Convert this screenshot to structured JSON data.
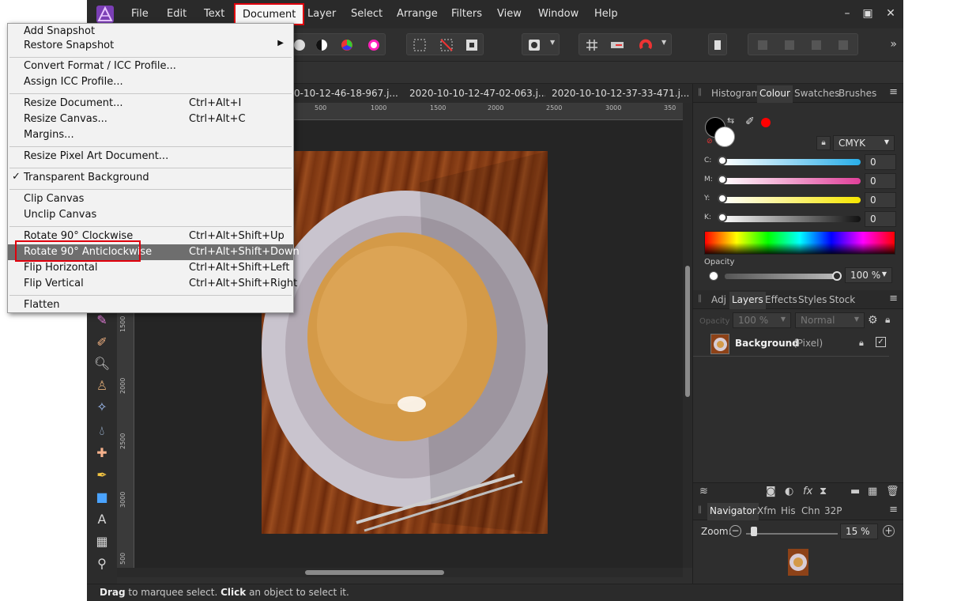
{
  "menubar": {
    "items": [
      "File",
      "Edit",
      "Text",
      "Document",
      "Layer",
      "Select",
      "Arrange",
      "Filters",
      "View",
      "Window",
      "Help"
    ],
    "active": "Document"
  },
  "document_menu": {
    "items": [
      {
        "label": "Add Snapshot",
        "shortcut": ""
      },
      {
        "label": "Restore Snapshot",
        "shortcut": "",
        "submenu": true
      },
      {
        "label": "Convert Format / ICC Profile...",
        "shortcut": ""
      },
      {
        "label": "Assign ICC Profile...",
        "shortcut": ""
      },
      {
        "label": "Resize Document...",
        "shortcut": "Ctrl+Alt+I"
      },
      {
        "label": "Resize Canvas...",
        "shortcut": "Ctrl+Alt+C"
      },
      {
        "label": "Margins...",
        "shortcut": ""
      },
      {
        "label": "Resize Pixel Art Document...",
        "shortcut": ""
      },
      {
        "label": "Transparent Background",
        "shortcut": "",
        "checked": true
      },
      {
        "label": "Clip Canvas",
        "shortcut": ""
      },
      {
        "label": "Unclip Canvas",
        "shortcut": ""
      },
      {
        "label": "Rotate 90° Clockwise",
        "shortcut": "Ctrl+Alt+Shift+Up"
      },
      {
        "label": "Rotate 90° Anticlockwise",
        "shortcut": "Ctrl+Alt+Shift+Down",
        "highlighted": true
      },
      {
        "label": "Flip Horizontal",
        "shortcut": "Ctrl+Alt+Shift+Left"
      },
      {
        "label": "Flip Vertical",
        "shortcut": "Ctrl+Alt+Shift+Right"
      },
      {
        "label": "Flatten",
        "shortcut": ""
      }
    ]
  },
  "doc_tabs": [
    {
      "label": "0-10-12-46-18-967.j...",
      "close": "×"
    },
    {
      "label": "2020-10-10-12-47-02-063.j...",
      "close": "×"
    },
    {
      "label": "2020-10-10-12-37-33-471.j...",
      "close": "×"
    }
  ],
  "ruler": {
    "top": [
      "500",
      "1000",
      "1500",
      "2000",
      "2500",
      "3000",
      "350"
    ],
    "left": [
      "1500",
      "2000",
      "2500",
      "3000",
      "500"
    ]
  },
  "colour_panel": {
    "tabs": [
      "Histogram",
      "Colour",
      "Swatches",
      "Brushes"
    ],
    "active_tab": "Colour",
    "model": "CMYK",
    "channels": [
      {
        "label": "C:",
        "value": "0"
      },
      {
        "label": "M:",
        "value": "0"
      },
      {
        "label": "Y:",
        "value": "0"
      },
      {
        "label": "K:",
        "value": "0"
      }
    ],
    "opacity_label": "Opacity",
    "opacity_value": "100 %"
  },
  "layers_panel": {
    "tabs": [
      "Adj",
      "Layers",
      "Effects",
      "Styles",
      "Stock"
    ],
    "active_tab": "Layers",
    "opacity_label": "Opacity",
    "opacity_value": "100 %",
    "blend_mode": "Normal",
    "layer_name": "Background",
    "layer_type": "(Pixel)"
  },
  "navigator_panel": {
    "tabs": [
      "Navigator",
      "Xfm",
      "His",
      "Chn",
      "32P"
    ],
    "active_tab": "Navigator",
    "zoom_label": "Zoom:",
    "zoom_value": "15 %"
  },
  "status": {
    "bold1": "Drag",
    "text1": " to marquee select. ",
    "bold2": "Click",
    "text2": " an object to select it."
  },
  "colors": {
    "accent_red": "#e0000c",
    "menu_highlight": "#6e6e6e",
    "primary_color": "#000000",
    "secondary_color": "#ffffff",
    "recent_color": "#ff0000"
  }
}
